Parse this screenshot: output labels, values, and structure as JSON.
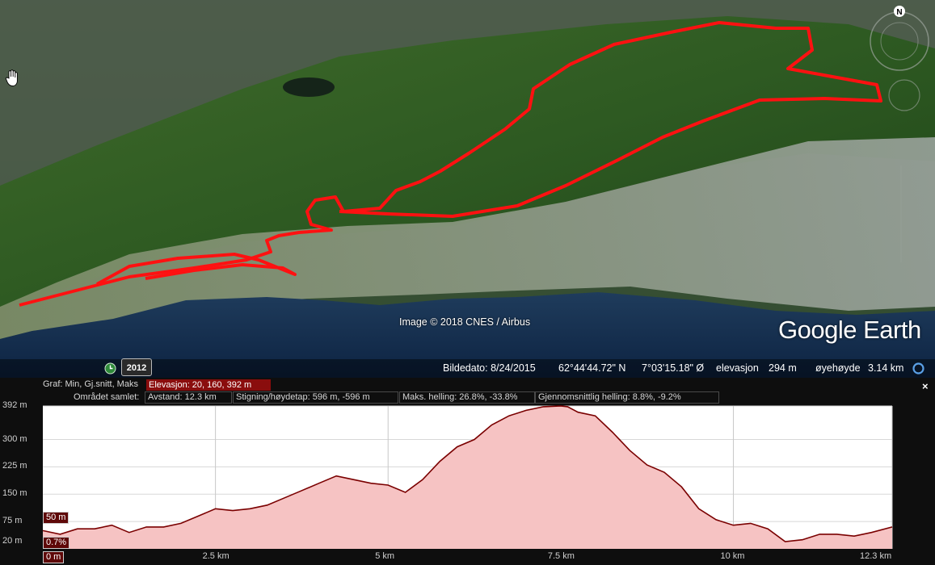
{
  "map": {
    "attribution": "Image © 2018 CNES / Airbus",
    "logo_google": "Google",
    "logo_earth": "Earth",
    "year_button": "2012",
    "compass_north": "N",
    "status": {
      "date_label": "Bildedato: 8/24/2015",
      "lat": "62°44'44.72\" N",
      "lon": "7°03'15.18\" Ø",
      "elev_label": "elevasjon",
      "elev_value": "294 m",
      "eye_label": "øyehøyde",
      "eye_value": "3.14 km"
    },
    "icons": [
      "hand-cursor-icon",
      "clock-icon",
      "globe-icon",
      "compass-icon"
    ],
    "route_color": "#ff1111"
  },
  "profile": {
    "graph_label": "Graf: Min, Gj.snitt, Maks",
    "elevation": "Elevasjon: 20, 160, 392 m",
    "area_label": "Området samlet:",
    "distance": "Avstand: 12.3 km",
    "climb": "Stigning/høydetap: 596 m, -596 m",
    "max_slope": "Maks. helling: 26.8%, -33.8%",
    "avg_slope": "Gjennomsnittlig helling: 8.8%, -9.2%",
    "close_symbol": "×",
    "cursor_elev": "50 m",
    "cursor_slope": "0.7%",
    "cursor_dist": "0 m"
  },
  "chart_data": {
    "type": "area",
    "xlabel": "",
    "ylabel": "",
    "ylim": [
      0,
      392
    ],
    "xlim": [
      0,
      12.3
    ],
    "y_ticks": [
      "392 m",
      "300 m",
      "225 m",
      "150 m",
      "75 m",
      "20 m"
    ],
    "y_tick_values": [
      392,
      300,
      225,
      150,
      75,
      20
    ],
    "x_ticks": [
      "2.5 km",
      "5 km",
      "7.5 km",
      "10 km",
      "12.3 km"
    ],
    "x_tick_values": [
      2.5,
      5,
      7.5,
      10,
      12.3
    ],
    "line_color": "#7a0000",
    "fill_color": "#f6c3c3",
    "series": [
      {
        "x": [
          0,
          0.25,
          0.5,
          0.75,
          1.0,
          1.25,
          1.5,
          1.75,
          2.0,
          2.25,
          2.5,
          2.75,
          3.0,
          3.25,
          3.5,
          3.75,
          4.0,
          4.25,
          4.5,
          4.75,
          5.0,
          5.25,
          5.5,
          5.75,
          6.0,
          6.25,
          6.5,
          6.75,
          7.0,
          7.25,
          7.5,
          7.6,
          7.75,
          8.0,
          8.25,
          8.5,
          8.75,
          9.0,
          9.25,
          9.5,
          9.75,
          10.0,
          10.25,
          10.5,
          10.75,
          11.0,
          11.25,
          11.5,
          11.75,
          12.0,
          12.3
        ],
        "y": [
          50,
          40,
          55,
          55,
          65,
          45,
          60,
          60,
          70,
          90,
          110,
          105,
          110,
          120,
          140,
          160,
          180,
          200,
          190,
          180,
          175,
          155,
          190,
          240,
          280,
          300,
          340,
          365,
          380,
          390,
          392,
          390,
          375,
          365,
          320,
          270,
          230,
          210,
          170,
          110,
          80,
          65,
          70,
          55,
          20,
          25,
          40,
          40,
          35,
          45,
          60
        ]
      }
    ]
  }
}
